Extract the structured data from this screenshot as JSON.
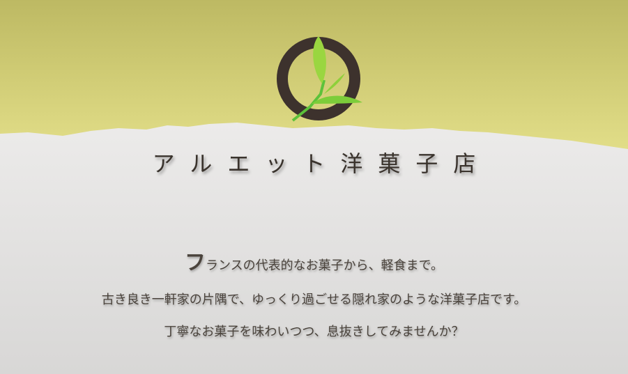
{
  "header": {
    "shop_name": "アルエット洋菓子店",
    "logo": "tea-leaf-ring-logo"
  },
  "intro": {
    "line1_first": "フ",
    "line1_rest": "ランスの代表的なお菓子から、軽食まで。",
    "line2": "古き良き一軒家の片隅で、ゆっくり過ごせる隠れ家のような洋菓子店です。",
    "line3": "丁寧なお菓子を味わいつつ、息抜きしてみませんか？"
  },
  "colors": {
    "band": "#cfcb74",
    "paper": "#e3e2e1",
    "ring": "#3d322d",
    "leaf": "#7ccd3a"
  }
}
